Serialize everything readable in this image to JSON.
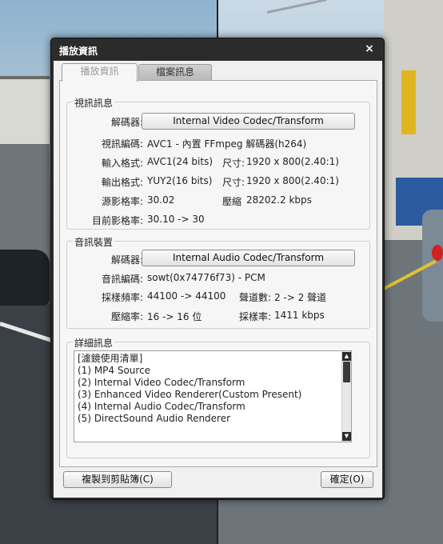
{
  "window": {
    "title": "播放資訊",
    "close_glyph": "×"
  },
  "tabs": [
    {
      "label": "播放資訊",
      "active": true
    },
    {
      "label": "檔案訊息",
      "active": false
    }
  ],
  "video": {
    "group_title": "視訊訊息",
    "decoder_label": "解碼器:",
    "decoder_value": "Internal Video Codec/Transform",
    "codec_label": "視訊編碼:",
    "codec_value": "AVC1 - 內置 FFmpeg 解碼器(h264)",
    "input_label": "輸入格式:",
    "input_value": "AVC1(24 bits)",
    "input_size_label": "尺寸:",
    "input_size_value": "1920 x 800(2.40:1)",
    "output_label": "輸出格式:",
    "output_value": "YUY2(16 bits)",
    "output_size_label": "尺寸:",
    "output_size_value": "1920 x 800(2.40:1)",
    "source_fps_label": "源影格率:",
    "source_fps_value": "30.02",
    "bitrate_label": "壓縮",
    "bitrate_value": "28202.2 kbps",
    "current_fps_label": "目前影格率:",
    "current_fps_value": "30.10 -> 30"
  },
  "audio": {
    "group_title": "音訊裝置",
    "decoder_label": "解碼器:",
    "decoder_value": "Internal Audio Codec/Transform",
    "codec_label": "音訊編碼:",
    "codec_value": "sowt(0x74776f73) - PCM",
    "sample_rate_label": "採樣頻率:",
    "sample_rate_value": "44100 -> 44100",
    "channels_label": "聲道數:",
    "channels_value": "2 -> 2 聲道",
    "compress_label": "壓縮率:",
    "compress_value": "16 -> 16 位",
    "sampling_label": "採樣率:",
    "sampling_value": "1411 kbps"
  },
  "details": {
    "group_title": "詳細訊息",
    "lines": [
      "[濾鏡使用清單]",
      "(1) MP4 Source",
      "(2) Internal Video Codec/Transform",
      "(3) Enhanced Video Renderer(Custom Present)",
      "(4) Internal Audio Codec/Transform",
      "(5) DirectSound Audio Renderer"
    ]
  },
  "buttons": {
    "copy": "複製到剪貼簿(C)",
    "ok": "確定(O)"
  },
  "colors": {
    "titlebar": "#2b2b2b",
    "client": "#f0f0f0"
  },
  "icons": {
    "close": "close-icon",
    "scroll_up": "scroll-up-arrow-icon",
    "scroll_down": "scroll-down-arrow-icon"
  }
}
